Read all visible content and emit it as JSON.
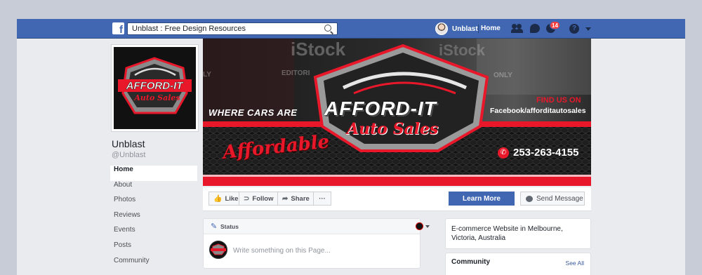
{
  "topbar": {
    "logo_letter": "f",
    "search_value": "Unblast : Free Design Resources",
    "user_name": "Unblast",
    "home_label": "Home",
    "notification_count": "14",
    "help_glyph": "?"
  },
  "page": {
    "name": "Unblast",
    "handle": "@Unblast"
  },
  "left_nav": {
    "items": [
      {
        "label": "Home"
      },
      {
        "label": "About"
      },
      {
        "label": "Photos"
      },
      {
        "label": "Reviews"
      },
      {
        "label": "Events"
      },
      {
        "label": "Posts"
      },
      {
        "label": "Community"
      }
    ]
  },
  "cover": {
    "tagline": "WHERE CARS ARE",
    "affordable": "Affordable",
    "logo_top": "AFFORD-IT",
    "logo_bottom": "Auto Sales",
    "find_us": "FIND US ON",
    "fb_url": "Facebook/afforditautosales",
    "phone": "253-263-4155",
    "watermark_1": "iStock",
    "watermark_2": "iStock",
    "watermark_editori": "EDITORI",
    "watermark_only_1": "LY",
    "watermark_only_2": "ONLY"
  },
  "profile_logo": {
    "top": "AFFORD-IT",
    "bottom": "Auto Sales"
  },
  "actions": {
    "like": "Like",
    "follow": "Follow",
    "share": "Share",
    "more": "···",
    "learn_more": "Learn More",
    "send_message": "Send Message"
  },
  "composer": {
    "tab": "Status",
    "placeholder": "Write something on this Page..."
  },
  "about": {
    "text": "E-commerce Website in Melbourne, Victoria, Australia"
  },
  "community": {
    "title": "Community",
    "see_all": "See All"
  },
  "colors": {
    "facebook_blue": "#4267b2",
    "brand_red": "#e8182a",
    "page_bg": "#e9ebee"
  }
}
